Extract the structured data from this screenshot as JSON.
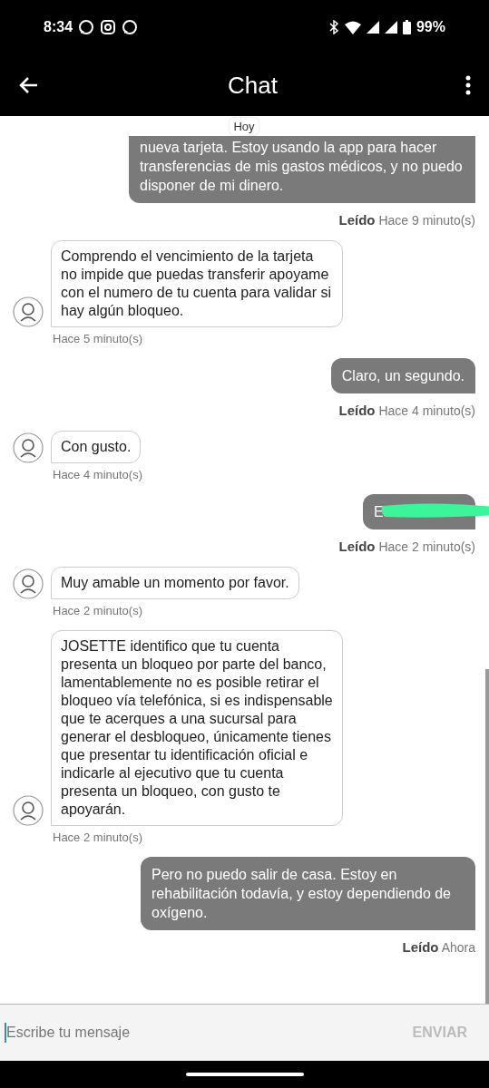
{
  "status_bar": {
    "time": "8:34",
    "battery": "99%"
  },
  "header": {
    "title": "Chat"
  },
  "date_chip": "Hoy",
  "messages": [
    {
      "kind": "sent",
      "text": "nueva tarjeta. Estoy usando la app para hacer transferencias de mis gastos médicos, y no puedo disponer de mi dinero.",
      "receipt": "Leído",
      "time": "Hace 9 minuto(s)"
    },
    {
      "kind": "received",
      "text": "Comprendo el vencimiento de la tarjeta no impide que puedas transferir apoyame con el numero de tu cuenta para validar si hay algún bloqueo.",
      "time": "Hace 5 minuto(s)"
    },
    {
      "kind": "sent",
      "text": "Claro, un segundo.",
      "receipt": "Leído",
      "time": "Hace 4 minuto(s)"
    },
    {
      "kind": "received",
      "text": "Con gusto.",
      "time": "Hace 4 minuto(s)"
    },
    {
      "kind": "sent",
      "text": "E",
      "redacted": true,
      "receipt": "Leído",
      "time": "Hace 2 minuto(s)"
    },
    {
      "kind": "received",
      "text": "Muy amable un momento por favor.",
      "time": "Hace 2 minuto(s)"
    },
    {
      "kind": "received",
      "text": "JOSETTE  identifico que tu cuenta presenta un bloqueo por parte del banco, lamentablemente no es posible retirar el bloqueo vía telefónica, si es indispensable que te acerques a una sucursal para generar el desbloqueo, únicamente tienes que presentar tu identificación oficial e indicarle al ejecutivo que tu cuenta presenta un bloqueo, con gusto te apoyarán.",
      "time": "Hace 2 minuto(s)"
    },
    {
      "kind": "sent",
      "text": "Pero no puedo salir de casa. Estoy en rehabilitación todavía, y estoy dependiendo de oxígeno.",
      "receipt": "Leído",
      "time": "Ahora"
    }
  ],
  "composer": {
    "placeholder": "Escribe tu mensaje",
    "send_label": "ENVIAR",
    "send_disabled": true
  }
}
